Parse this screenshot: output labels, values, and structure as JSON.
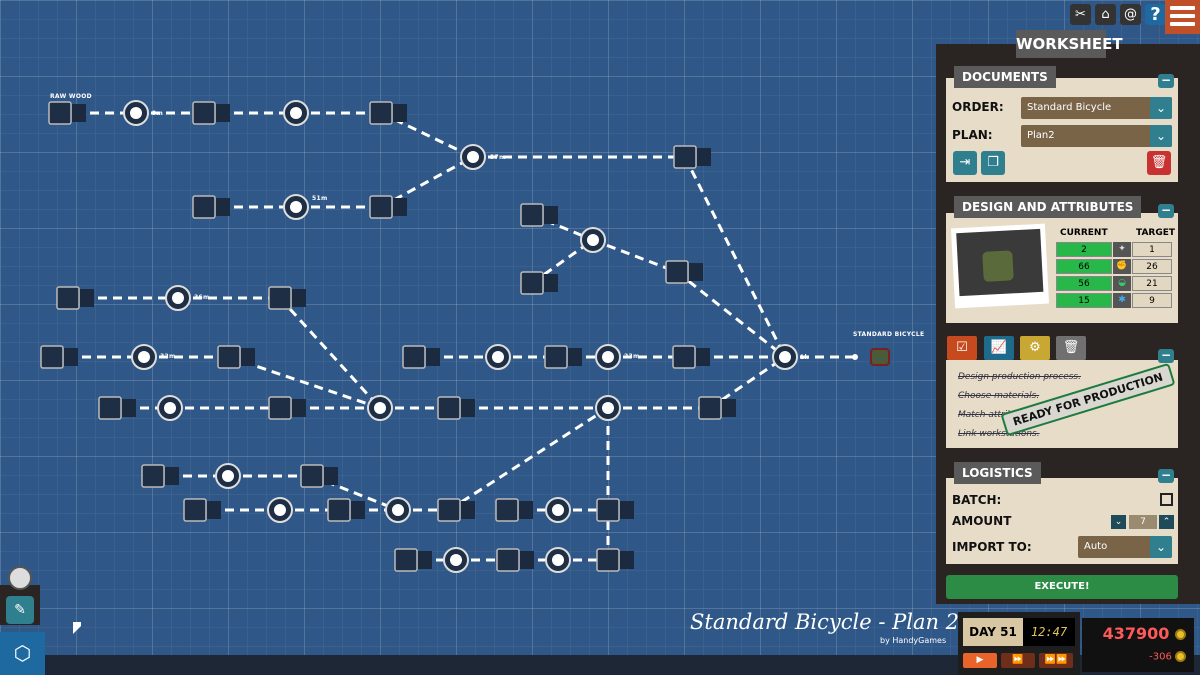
{
  "board": {
    "labels": {
      "raw_wood": "RAW WOOD",
      "output": "STANDARD BICYCLE"
    },
    "times": {
      "t1": "9m",
      "t2": "57m",
      "t3": "1h",
      "t4": "51m",
      "t5": "36m",
      "t6": "32m",
      "t7": "23m"
    },
    "plan_title": "Standard Bicycle - Plan 2",
    "credit": "by HandyGames"
  },
  "topbar": {
    "icons": [
      "tools-icon",
      "home-icon",
      "snail-icon",
      "help-icon"
    ],
    "help": "?"
  },
  "worksheet": {
    "title": "WORKSHEET",
    "documents": {
      "tab": "DOCUMENTS",
      "order_label": "ORDER:",
      "order_value": "Standard Bicycle",
      "plan_label": "PLAN:",
      "plan_value": "Plan2"
    },
    "design": {
      "tab": "DESIGN AND ATTRIBUTES",
      "current_header": "CURRENT",
      "target_header": "TARGET",
      "rows": [
        {
          "current": "2",
          "target": "1",
          "icon": "weight-icon"
        },
        {
          "current": "66",
          "target": "26",
          "icon": "strength-icon"
        },
        {
          "current": "56",
          "target": "21",
          "icon": "comfort-icon"
        },
        {
          "current": "15",
          "target": "9",
          "icon": "style-icon"
        }
      ],
      "current_color": "#28b84a"
    },
    "checklist": {
      "items": [
        "Design production process.",
        "Choose materials.",
        "Match attributes.",
        "Link workstations."
      ],
      "stamp": "READY FOR PRODUCTION"
    },
    "logistics": {
      "tab": "LOGISTICS",
      "batch_label": "BATCH:",
      "batch_checked": false,
      "amount_label": "AMOUNT",
      "amount_value": "7",
      "import_label": "IMPORT TO:",
      "import_value": "Auto"
    },
    "execute": "EXECUTE!"
  },
  "status": {
    "day": "DAY 51",
    "time": "12:47",
    "money": "437900",
    "delta": "-306",
    "money_color": "#ff5a5a"
  }
}
